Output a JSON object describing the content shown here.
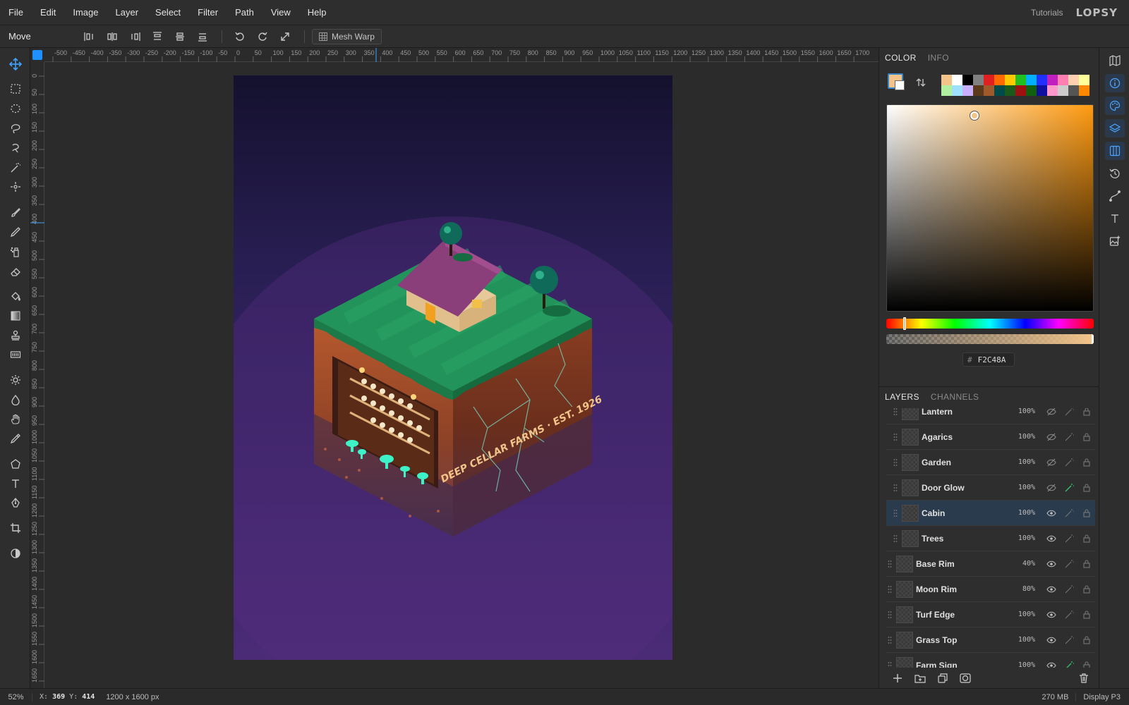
{
  "menubar": {
    "items": [
      "File",
      "Edit",
      "Image",
      "Layer",
      "Select",
      "Filter",
      "Path",
      "View",
      "Help"
    ],
    "tutorials": "Tutorials",
    "logo": "LOPSY"
  },
  "options": {
    "tool_name": "Move",
    "mesh_warp": "Mesh Warp"
  },
  "ruler": {
    "top_labels": [
      "-500",
      "-450",
      "-400",
      "-350",
      "-300",
      "-250",
      "-200",
      "-150",
      "-100",
      "-50",
      "0",
      "50",
      "100",
      "150",
      "200",
      "250",
      "300",
      "350",
      "400",
      "450",
      "500",
      "550",
      "600",
      "650",
      "700",
      "750",
      "800",
      "850",
      "900",
      "950",
      "1000",
      "1050",
      "1100",
      "1150",
      "1200",
      "1250",
      "1300",
      "1350",
      "1400",
      "1450",
      "1500",
      "1550",
      "1600",
      "1650",
      "1700"
    ],
    "left_labels": [
      "0",
      "50",
      "100",
      "150",
      "200",
      "250",
      "300",
      "350",
      "400",
      "450",
      "500",
      "550",
      "600",
      "650",
      "700",
      "750",
      "800",
      "850",
      "900",
      "950",
      "1000",
      "1050",
      "1100",
      "1150",
      "1200",
      "1250",
      "1300",
      "1350",
      "1400",
      "1450",
      "1500",
      "1550",
      "1600",
      "1650"
    ]
  },
  "artwork": {
    "sign_text": "DEEP CELLAR FARMS · EST. 1926"
  },
  "color_panel": {
    "tabs": [
      "COLOR",
      "INFO"
    ],
    "active_tab": "COLOR",
    "foreground": "#F2C48A",
    "background": "#FFFFFF",
    "hex_label": "#",
    "hex_value": "F2C48A",
    "palette": [
      "#f2c48a",
      "#ffffff",
      "#000000",
      "#808080",
      "#e02020",
      "#ff6a00",
      "#ffc800",
      "#20c020",
      "#00b0ff",
      "#2030ff",
      "#c020c0",
      "#ff80b0",
      "#ffd0b0",
      "#ffff99",
      "#b0f0a0",
      "#a0e0ff",
      "#c8b0ff",
      "#5a3a1a",
      "#a05a2a",
      "#004a4a",
      "#1a5a1a",
      "#a01010",
      "#106010",
      "#1010a0",
      "#ff99cc",
      "#cccccc",
      "#555555",
      "#ff8800"
    ]
  },
  "layers_panel": {
    "tabs": [
      "LAYERS",
      "CHANNELS"
    ],
    "active_tab": "LAYERS",
    "layers": [
      {
        "name": "Lantern",
        "opacity": "100%",
        "visible": false,
        "fx": false,
        "indent": true
      },
      {
        "name": "Agarics",
        "opacity": "100%",
        "visible": false,
        "fx": false,
        "indent": true
      },
      {
        "name": "Garden",
        "opacity": "100%",
        "visible": false,
        "fx": false,
        "indent": true
      },
      {
        "name": "Door Glow",
        "opacity": "100%",
        "visible": false,
        "fx": true,
        "indent": true
      },
      {
        "name": "Cabin",
        "opacity": "100%",
        "visible": true,
        "fx": false,
        "indent": true,
        "selected": true
      },
      {
        "name": "Trees",
        "opacity": "100%",
        "visible": true,
        "fx": false,
        "indent": true
      },
      {
        "name": "Base Rim",
        "opacity": "40%",
        "visible": true,
        "fx": false,
        "indent": false
      },
      {
        "name": "Moon Rim",
        "opacity": "80%",
        "visible": true,
        "fx": false,
        "indent": false
      },
      {
        "name": "Turf Edge",
        "opacity": "100%",
        "visible": true,
        "fx": false,
        "indent": false
      },
      {
        "name": "Grass Top",
        "opacity": "100%",
        "visible": true,
        "fx": false,
        "indent": false
      },
      {
        "name": "Farm Sign",
        "opacity": "100%",
        "visible": true,
        "fx": true,
        "indent": false
      }
    ]
  },
  "status": {
    "zoom": "52%",
    "x_label": "X:",
    "x": "369",
    "y_label": "Y:",
    "y": "414",
    "dimensions": "1200 x 1600 px",
    "memory": "270 MB",
    "profile": "Display P3"
  }
}
